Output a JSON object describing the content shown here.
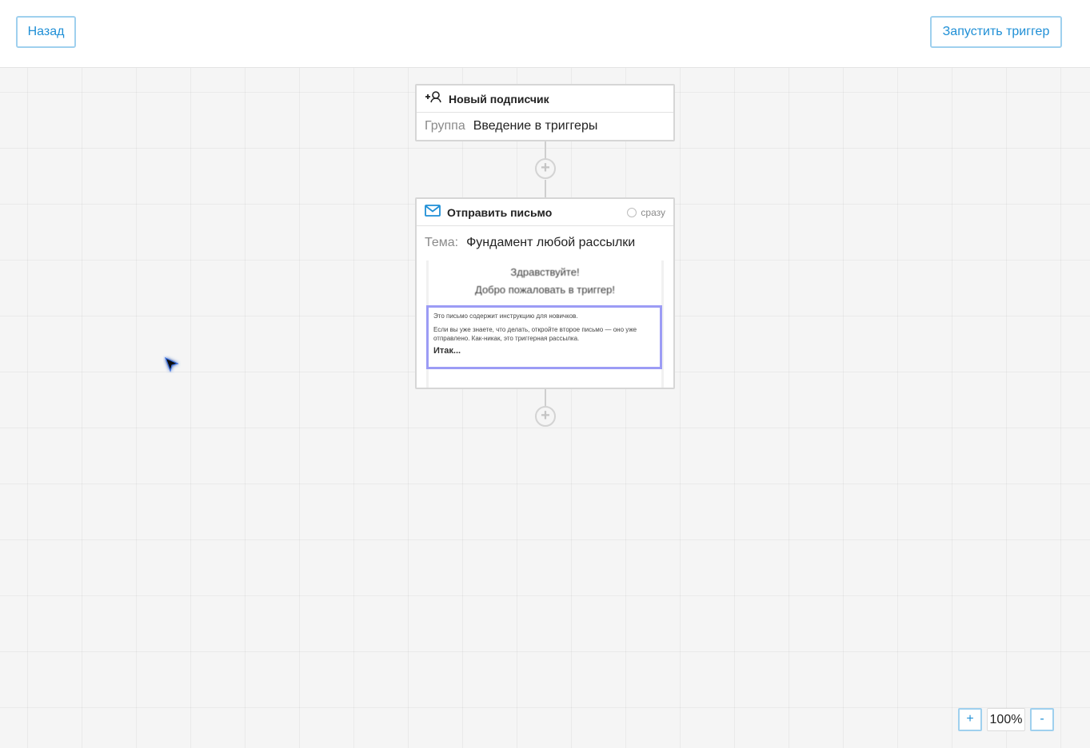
{
  "header": {
    "back_label": "Назад",
    "run_label": "Запустить триггер"
  },
  "trigger_node": {
    "title": "Новый подписчик",
    "group_label": "Группа",
    "group_value": "Введение в триггеры"
  },
  "mail_node": {
    "title": "Отправить письмо",
    "delay": "сразу",
    "subject_label": "Тема:",
    "subject_value": "Фундамент любой рассылки",
    "preview": {
      "greeting": "Здравствуйте!",
      "welcome": "Добро пожаловать в триггер!",
      "line1": "Это письмо содержит инструкцию для новичков.",
      "line2": "Если вы уже знаете, что делать, откройте второе письмо — оно уже отправлено. Как-никак, это триггерная рассылка.",
      "line3": "Итак..."
    }
  },
  "zoom": {
    "plus_label": "+",
    "level": "100%",
    "minus_label": "-"
  },
  "icons": {
    "subscriber": "add-user-icon",
    "mail": "envelope-icon",
    "delay": "clock-icon",
    "add_step": "plus-circle-icon",
    "cursor": "mouse-cursor-icon"
  },
  "colors": {
    "accent": "#1f8fd6",
    "button_border": "#9fd0ee",
    "highlight_border": "#9c9cf5"
  }
}
